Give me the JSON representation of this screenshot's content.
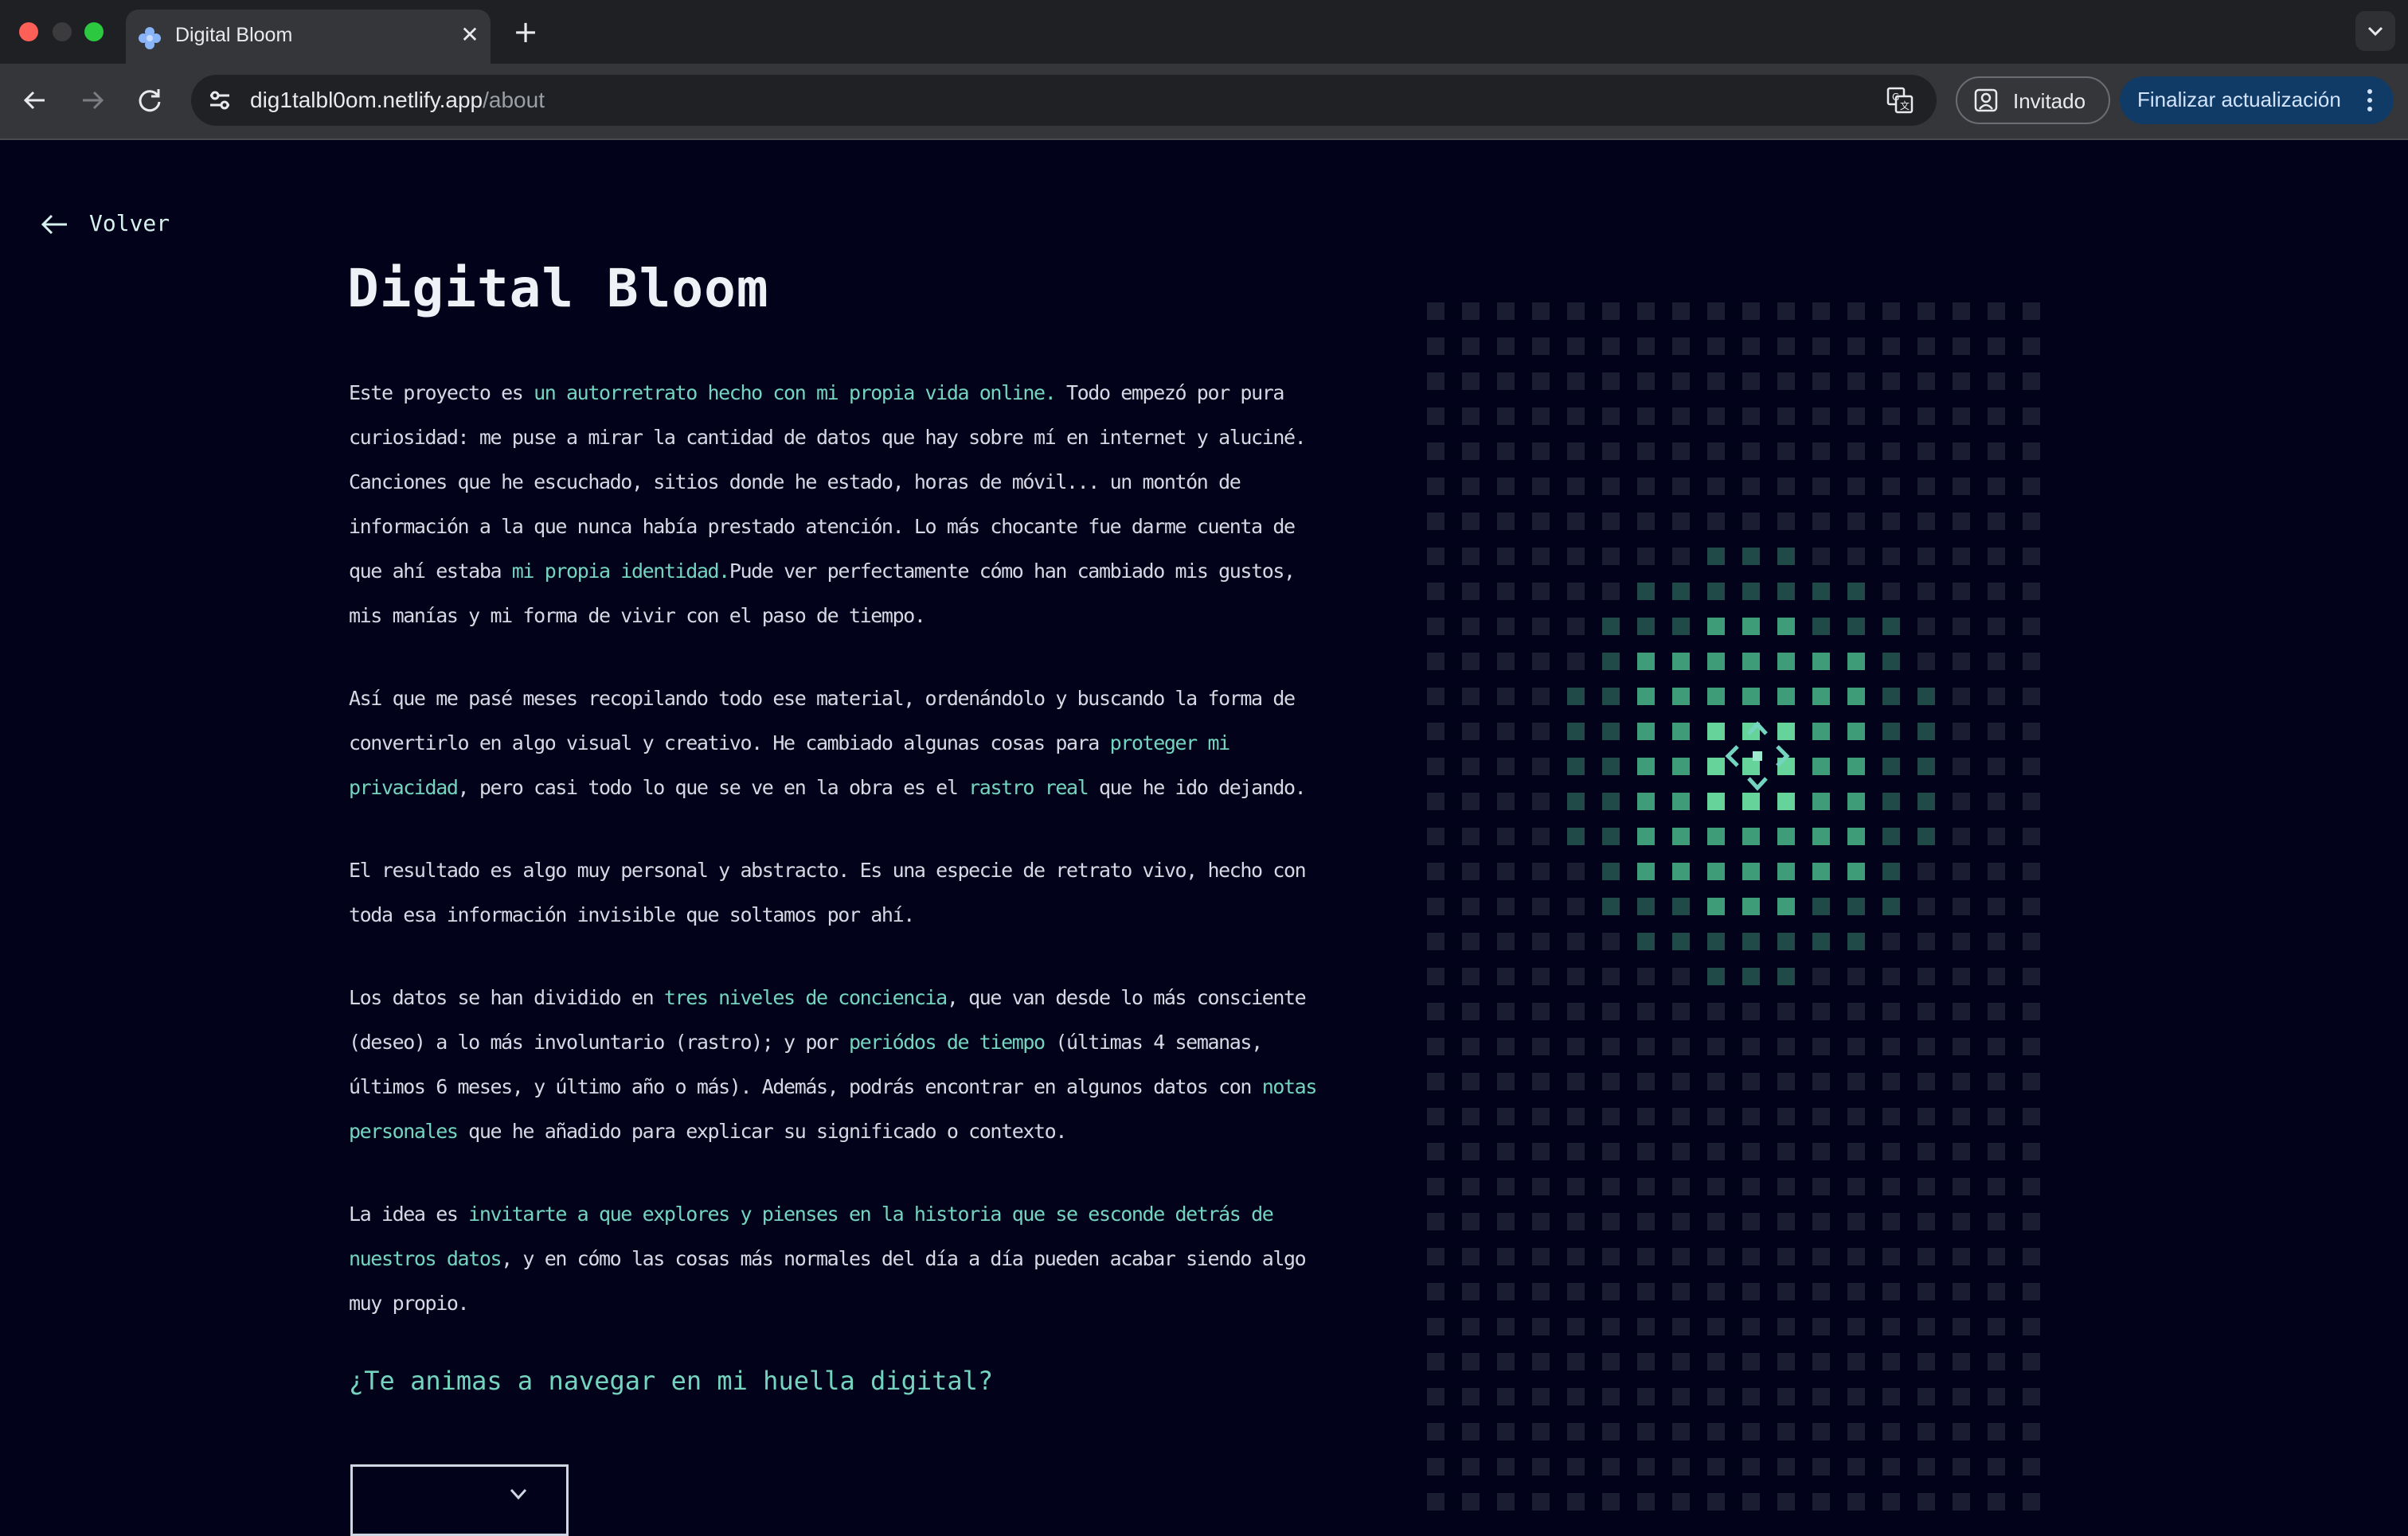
{
  "browser": {
    "tab_title": "Digital Bloom",
    "url_host": "dig1talbl0om.netlify.app",
    "url_path": "/about",
    "guest_label": "Invitado",
    "update_label": "Finalizar actualización"
  },
  "page": {
    "back_label": "Volver",
    "title": "Digital Bloom",
    "paragraphs": [
      {
        "t1": "Este proyecto es ",
        "h1": "un autorretrato hecho con mi propia vida online.",
        "t2": " Todo empezó por pura curiosidad: me puse a mirar la cantidad de datos que hay sobre mí en internet y aluciné. Canciones que he escuchado, sitios donde he estado, horas de móvil... un montón de información a la que nunca había prestado atención. Lo más chocante fue darme cuenta de que ahí estaba ",
        "h2": "mi propia identidad.",
        "t3": "Pude ver perfectamente cómo han cambiado mis gustos, mis manías y mi forma de vivir con el paso de tiempo."
      },
      {
        "t1": "Así que me pasé meses recopilando todo ese material, ordenándolo y buscando la forma de convertirlo en algo visual y creativo. He cambiado algunas cosas para ",
        "h1": "proteger mi privacidad",
        "t2": ", pero casi todo lo que se ve en la obra es el ",
        "h2": "rastro real",
        "t3": " que he ido dejando."
      },
      {
        "t1": "El resultado es algo muy personal y abstracto. Es una especie de retrato vivo, hecho con toda esa información invisible que soltamos por ahí."
      },
      {
        "t1": "Los datos se han dividido en ",
        "h1": "tres niveles de conciencia",
        "t2": ", que van desde lo más consciente (deseo) a lo más involuntario (rastro); y por ",
        "h2": "periódos de tiempo",
        "t3": " (últimas 4 semanas, últimos 6 meses, y último año o más). Además, podrás encontrar en algunos datos con ",
        "h3": "notas personales",
        "t4": " que he añadido para explicar su significado o contexto."
      },
      {
        "t1": "La idea es ",
        "h1": "invitarte a que explores y pienses en la historia que se esconde detrás de nuestros datos",
        "t2": ", y en cómo las cosas más normales del día a día pueden acabar siendo algo muy propio."
      }
    ],
    "question": "¿Te animas a navegar en mi huella digital?"
  },
  "colors": {
    "background": "#02031a",
    "accent": "#74d4bf",
    "grid_dim": "#1b1d33",
    "grid_mid": "#1f4a48",
    "grid_bright": "#3f9c79",
    "grid_core": "#66d49a"
  }
}
